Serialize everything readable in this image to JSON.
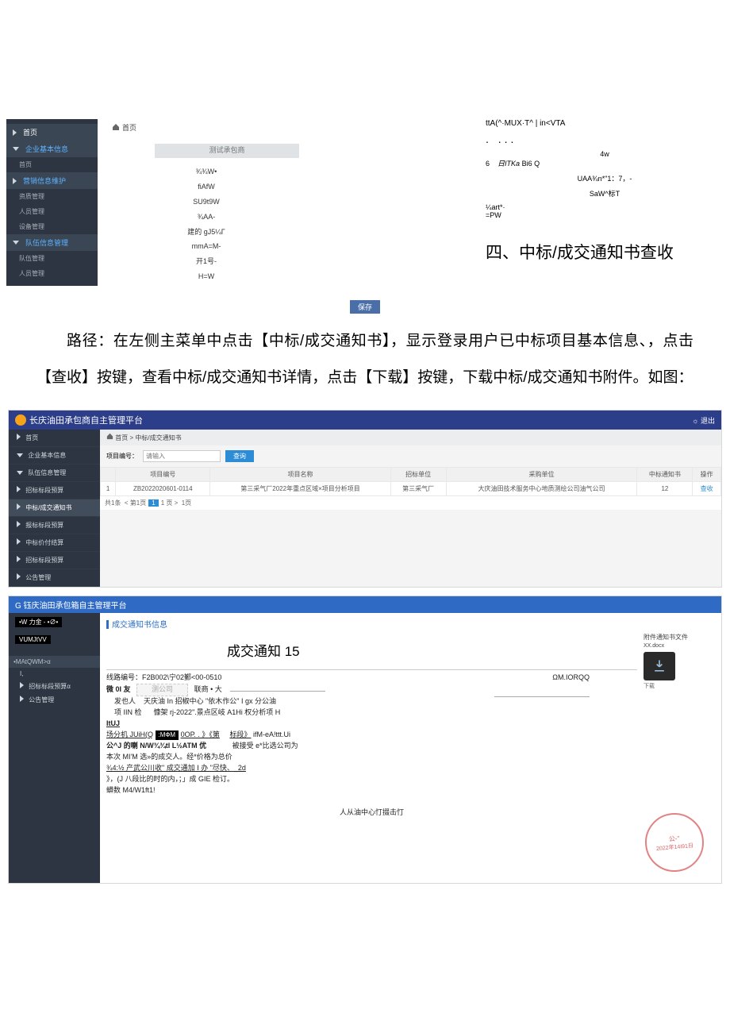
{
  "top": {
    "sidebar": {
      "home": "首页",
      "group1": "企业基本信息",
      "g1_items": [
        "首页"
      ],
      "group2": "营销信息维护",
      "g2_items": [
        "资质管理",
        "人员管理",
        "设备管理"
      ],
      "group3": "队伍信息管理",
      "g3_items": [
        "队伍管理",
        "人员管理"
      ]
    },
    "crumb_home": "首页",
    "gray_input": "测试承包商",
    "mid_lines": [
      "¾¾W•",
      "fiAfW",
      "SU9t9W",
      "¾AA-",
      "建的 gJ5¼Γ",
      "mmA=M-",
      "开1号-",
      "H=W"
    ],
    "right_lines": {
      "l1": "ttA(^·MUX·T^ | in<VTA",
      "dots": ". ...",
      "l2a": "4w",
      "l2b_pre": "6",
      "l2b": "日ITKa",
      "l2b_suf": "Bi6    Q",
      "l3": "UAA¾n*\"1：7，-",
      "l4": "SaW^标T",
      "l5": "¼art*·",
      "l6": "=PW"
    },
    "section_title": "四、中标/成交通知书查收",
    "blue_btn": "保存"
  },
  "body_text": "路径：在左侧主菜单中点击【中标/成交通知书】，显示登录用户已中标项目基本信息、，点击【查收】按键，查看中标/成交通知书详情，点击【下载】按键，下载中标/成交通知书附件。如图：",
  "shot2": {
    "title": "长庆油田承包商自主管理平台",
    "right_btn": "退出",
    "sidebar": [
      "首页",
      "企业基本信息",
      "队伍信息管理",
      "招标标段预算",
      "中标/成交通知书",
      "报标标段预算",
      "中标价付结算",
      "招标标段预算",
      "公告管理"
    ],
    "crumb": "首页 > 中标/成交通知书",
    "search_label": "项目编号：",
    "search_ph": "请输入",
    "search_btn": "查询",
    "headers": [
      "",
      "项目编号",
      "项目名称",
      "招标单位",
      "采购单位",
      "中标通知书",
      "操作"
    ],
    "row": [
      "1",
      "ZB2022020601-0114",
      "第三采气厂2022年重点区域×项目分析项目",
      "第三采气厂",
      "大庆油田技术服务中心地质测绘公司油气公司",
      "12",
      "查收"
    ],
    "pager_text": "共1条  < 第1页   /  1  页 >  1页"
  },
  "shot3": {
    "title": "G 钰庆油田承包箱自主管理平台",
    "sidebar_tags": [
      "•W 力金 - •∅•",
      "VUMJtVV"
    ],
    "sidebar_sect": "•MAtQWM>α",
    "sidebar_items": [
      "I,",
      "招标标段预算α",
      "公告管理"
    ],
    "panel_title": "成交通知书信息",
    "doc_title": "成交通知 15",
    "line_no_label": "线路编号：",
    "line_no": "F2B002\\宁02鄞<00-0510",
    "supplier_label": "微 0I 友",
    "supplier_input": "测公司",
    "om": "ΩM.IORQQ",
    "contact_label": "联商 • 大",
    "sender_label": "发也人",
    "sender": "天庆油 In 招椒中心 \"依木作公\" I gx 分公油",
    "proj_label": "项 IIN 检",
    "proj": "慷架 rj-2022\".景点区岐 A1Hi 权分析项 H",
    "ituj": "ItUJ",
    "seg_label": "场分机 JUiH(Q",
    "seg_black": ":МФМ",
    "seg_rest": "0OP. . 》《第",
    "bid_label": "标段》",
    "bid_rest": "ifM-eA!ttt.Ui",
    "line_a": "公^J 的喇 N/W¾¾tl  L½ATM 优",
    "line_a2": "被接受 e*比选公司为",
    "line_b": "本次 MI'M 选»的成交人。经*价格为总价",
    "line_c": "¾4:½             产武公川收\" 成交通加 I 办 \"尽快、_2d",
    "line_d": "》，(J         八段比的时的内，；」成 GIE 检订。",
    "line_e": "蟒数 M4/W1ft1!",
    "bottom": "人从油中心忊掇击忊",
    "stamp_text1": "公-\"",
    "stamp_text2": "2022年14I91日",
    "dl_label": "附件通知书文件",
    "dl_name": "XX.docx",
    "dl_action": "下载"
  }
}
